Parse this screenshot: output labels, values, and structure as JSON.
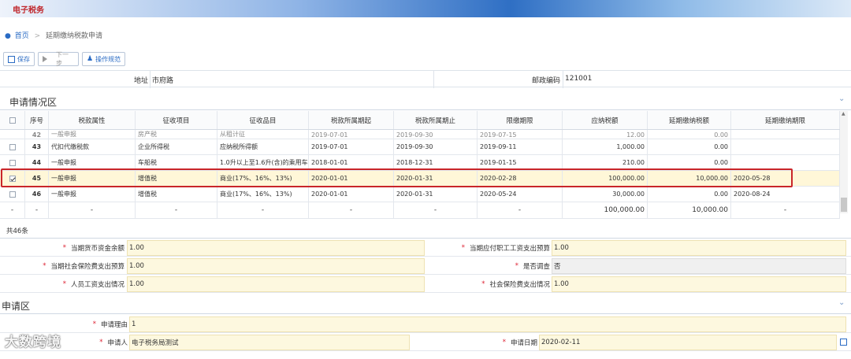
{
  "banner": {
    "logo": "电子税务"
  },
  "breadcrumb": {
    "home": "首页",
    "sep": ">",
    "current": "延期缴纳税款申请"
  },
  "toolbar": {
    "save": "保存",
    "next": "下一步",
    "guide": "操作规范"
  },
  "address": {
    "addr_label": "地址",
    "addr_value": "市府路",
    "postcode_label": "邮政编码",
    "postcode_value": "121001"
  },
  "section1": {
    "title": "申请情况区"
  },
  "table": {
    "headers": [
      "序号",
      "税款属性",
      "征收项目",
      "征收品目",
      "税款所属期起",
      "税款所属期止",
      "限缴期限",
      "应纳税额",
      "延期缴纳税额",
      "延期缴纳期限"
    ],
    "clipped_row": [
      "42",
      "一般申报",
      "房产税",
      "从租计征",
      "2019-07-01",
      "2019-09-30",
      "2019-07-15",
      "12.00",
      "0.00",
      ""
    ],
    "rows": [
      {
        "no": "43",
        "attr": "代扣代缴税款",
        "item": "企业所得税",
        "sub": "应纳税所得额",
        "start": "2019-07-01",
        "end": "2019-09-30",
        "due": "2019-09-11",
        "tax": "1,000.00",
        "defer": "0.00",
        "limit": "",
        "checked": false
      },
      {
        "no": "44",
        "attr": "一般申报",
        "item": "车船税",
        "sub": "1.0升以上至1.6升(含)的乘用车",
        "start": "2018-01-01",
        "end": "2018-12-31",
        "due": "2019-01-15",
        "tax": "210.00",
        "defer": "0.00",
        "limit": "",
        "checked": false
      },
      {
        "no": "45",
        "attr": "一般申报",
        "item": "增值税",
        "sub": "商业(17%、16%、13%)",
        "start": "2020-01-01",
        "end": "2020-01-31",
        "due": "2020-02-28",
        "tax": "100,000.00",
        "defer": "10,000.00",
        "limit": "2020-05-28",
        "checked": true
      },
      {
        "no": "46",
        "attr": "一般申报",
        "item": "增值税",
        "sub": "商业(17%、16%、13%)",
        "start": "2020-01-01",
        "end": "2020-01-31",
        "due": "2020-05-24",
        "tax": "30,000.00",
        "defer": "0.00",
        "limit": "2020-08-24",
        "checked": false
      }
    ],
    "totals": {
      "dash": "-",
      "tax": "100,000.00",
      "defer": "10,000.00"
    },
    "count": "共46条"
  },
  "form1": {
    "f1_label": "当期货币资金余额",
    "f1_value": "1.00",
    "f2_label": "当期应付职工工资支出预算",
    "f2_value": "1.00",
    "f3_label": "当期社会保险费支出预算",
    "f3_value": "1.00",
    "f4_label": "是否调查",
    "f4_value": "否",
    "f5_label": "人员工资支出情况",
    "f5_value": "1.00",
    "f6_label": "社会保险费支出情况",
    "f6_value": "1.00",
    "req": "*"
  },
  "section2": {
    "title": "申请区"
  },
  "form2": {
    "reason_label": "申请理由",
    "reason_value": "1",
    "applicant_label": "申请人",
    "applicant_value": "电子税务局测试",
    "date_label": "申请日期",
    "date_value": "2020-02-11"
  },
  "watermark": "大数跨境",
  "colors": {
    "accent": "#2a6bc4",
    "highlight": "#c9262a",
    "field_bg": "#fdf8df",
    "selected_row": "#fff7d8"
  }
}
